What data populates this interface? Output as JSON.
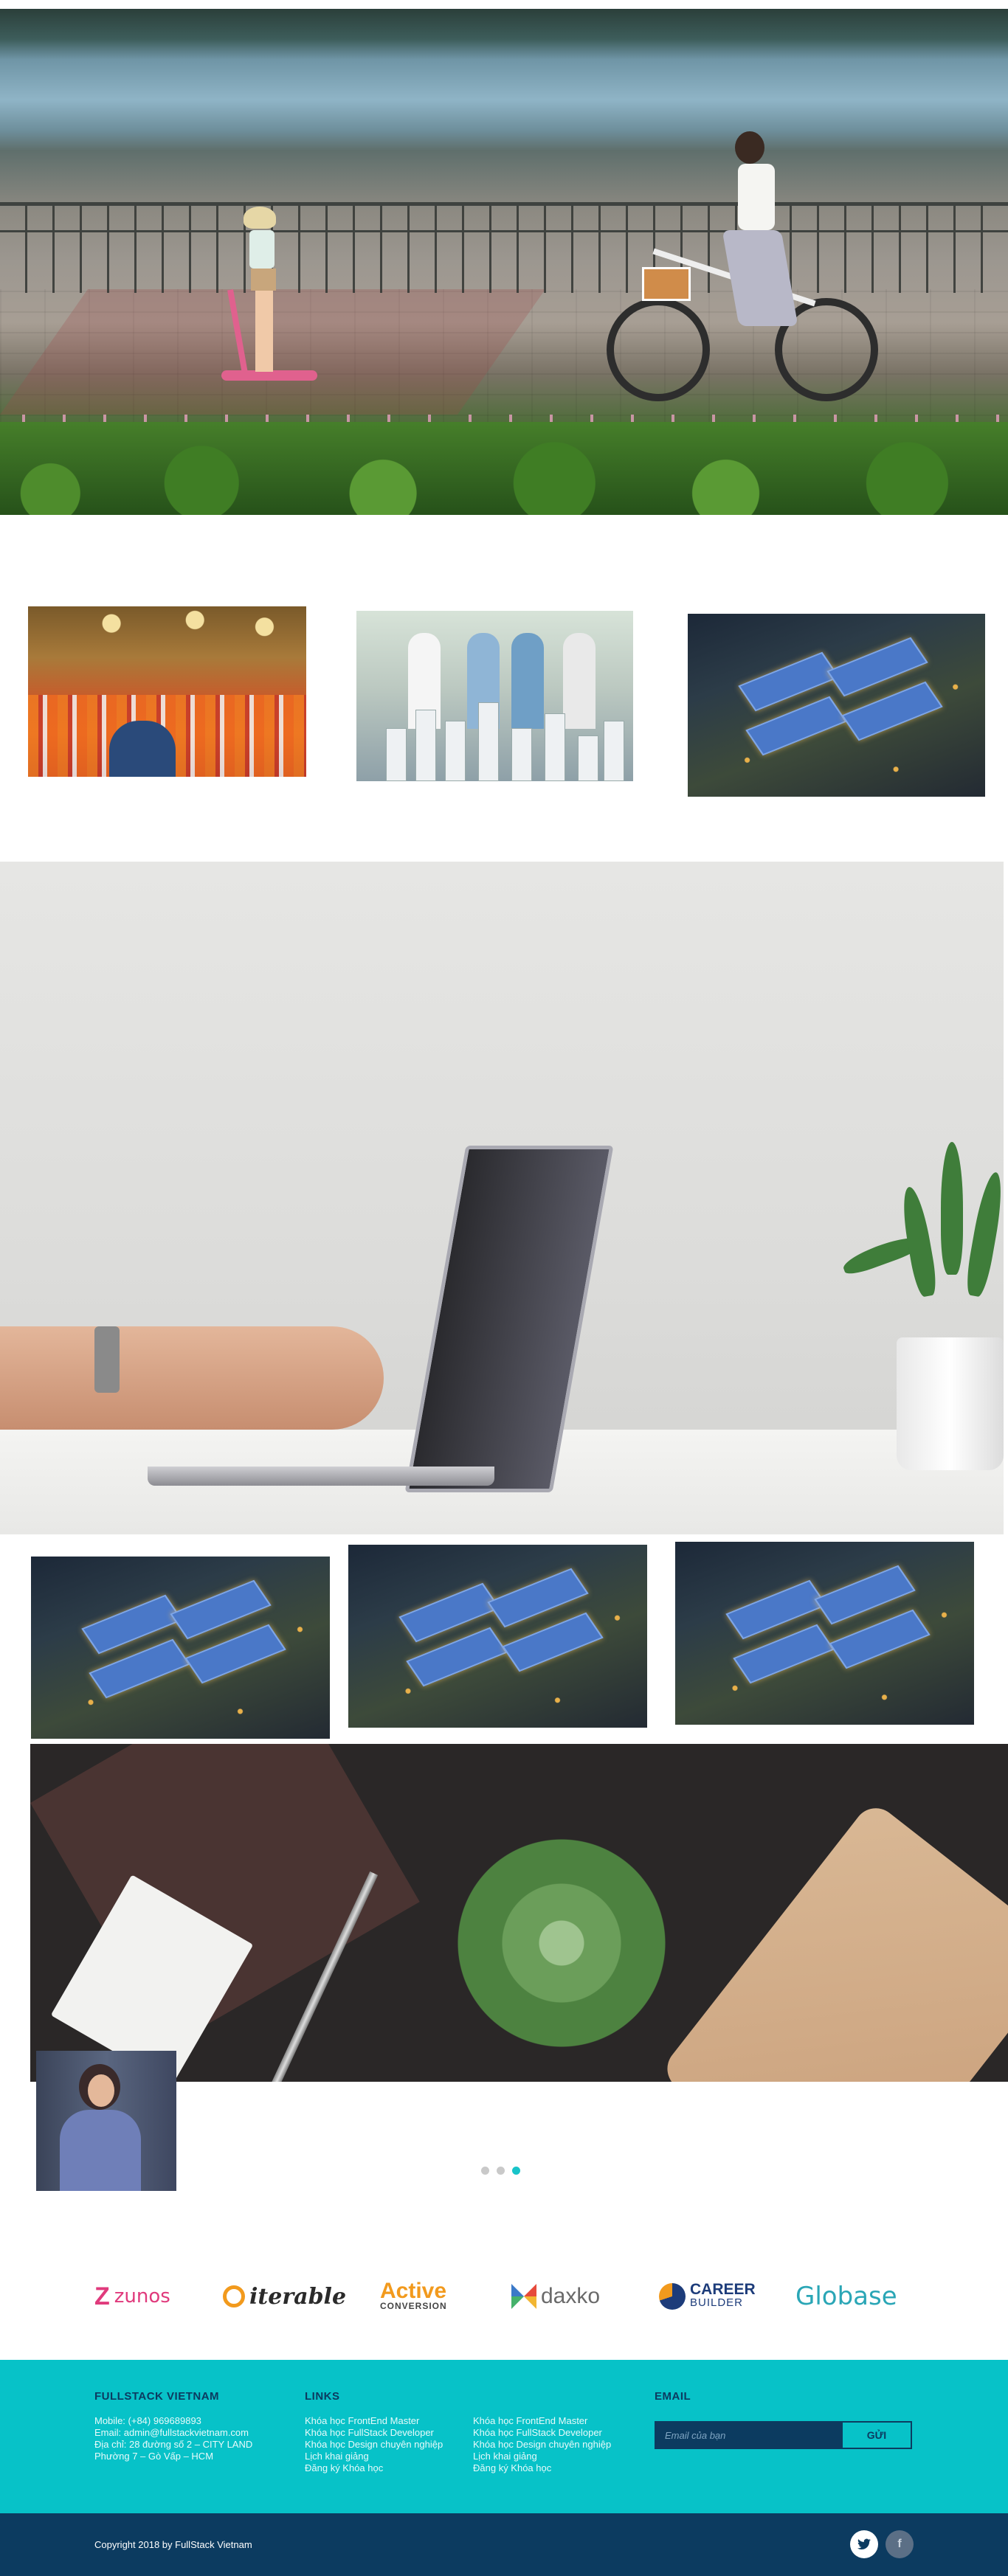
{
  "slider": {
    "dots": [
      "slide-1",
      "slide-2",
      "slide-3"
    ],
    "active_index": 2
  },
  "partners": [
    {
      "name": "zunos",
      "color": "#e03a7c"
    },
    {
      "name": "iterable",
      "color": "#2a2a2a"
    },
    {
      "name": "Active",
      "sub": "CONVERSION",
      "color": "#f29a1d"
    },
    {
      "name": "daxko",
      "color": "#6a6a6a"
    },
    {
      "name": "CAREER",
      "sub": "BUILDER",
      "color": "#1d3c7a"
    },
    {
      "name": "Globase",
      "color": "#2aa6b6"
    }
  ],
  "footer": {
    "company": {
      "heading": "FULLSTACK VIETNAM",
      "lines": [
        "Mobile: (+84) 969689893",
        "Email: admin@fullstackvietnam.com",
        "Địa chỉ: 28 đường số 2 – CITY LAND",
        "Phường 7 – Gò Vấp – HCM"
      ]
    },
    "links": {
      "heading": "LINKS",
      "col1": [
        "Khóa học FrontEnd Master",
        "Khóa học FullStack Developer",
        "Khóa học Design chuyên nghiệp",
        "Lịch khai giảng",
        "Đăng ký Khóa học"
      ],
      "col2": [
        "Khóa học FrontEnd Master",
        "Khóa học FullStack Developer",
        "Khóa học Design chuyên nghiệp",
        "Lịch khai giảng",
        "Đăng ký Khóa học"
      ]
    },
    "email": {
      "heading": "EMAIL",
      "placeholder": "Email của bạn",
      "button": "GỬI"
    }
  },
  "bottom": {
    "copyright": "Copyright 2018 by FullStack Vietnam",
    "social": [
      {
        "name": "twitter-icon",
        "glyph": "🐦",
        "bg": "#ffffff",
        "fg": "#0c3b60"
      },
      {
        "name": "facebook-icon",
        "glyph": "f",
        "bg": "#5b6f86",
        "fg": "#c9d3de"
      }
    ]
  },
  "colors": {
    "accent": "#07c2c8",
    "dark": "#0c3b60"
  }
}
